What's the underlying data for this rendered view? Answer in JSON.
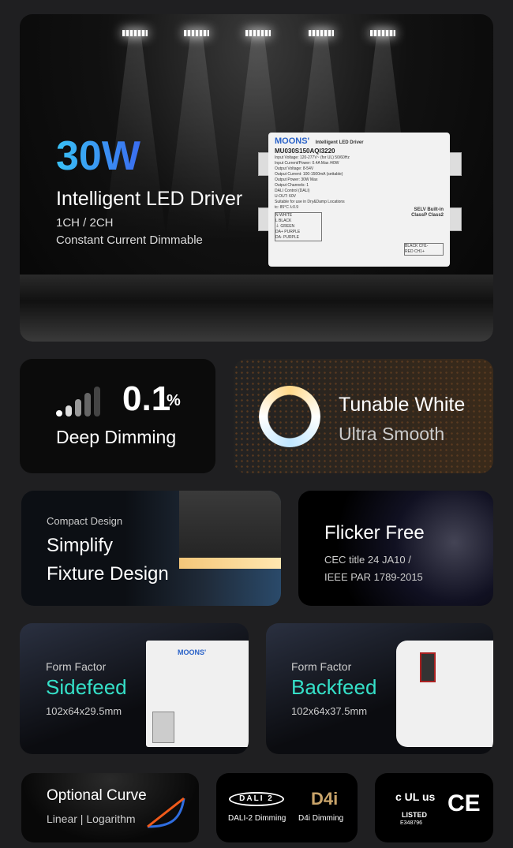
{
  "hero": {
    "power": "30W",
    "title": "Intelligent LED Driver",
    "channels": "1CH / 2CH",
    "subtitle": "Constant Current Dimmable",
    "label": {
      "brand": "MOONS'",
      "heading": "Intelligent LED Driver",
      "model": "MU030S150AQI3220",
      "lines": [
        "Input Voltage: 120-277V~ (for UL) 50/60Hz",
        "Input Current/Power: 0.4A Max /40W",
        "Output Voltage: 8-54V",
        "Output Current: 100-1500mA (settable)",
        "Output Power: 30W Max",
        "Output Channels: 1",
        "DALI Control (DALI)",
        "U-OUT: 60V",
        "Suitable for use in Dry&Damp Locations",
        "tc: 85°C  λ:0.9"
      ],
      "wiring": [
        "N WHITE",
        "L BLACK",
        "⏚ GREEN",
        "DA+ PURPLE",
        "DA- PURPLE"
      ],
      "outputs": [
        "BLACK CH1-",
        "RED CH1+"
      ],
      "selv": "SELV Built-in",
      "class": "ClassP Class2"
    }
  },
  "deep_dimming": {
    "value": "0.1",
    "unit": "%",
    "label": "Deep Dimming"
  },
  "tunable": {
    "title": "Tunable White",
    "subtitle": "Ultra Smooth"
  },
  "compact": {
    "kicker": "Compact Design",
    "line1": "Simplify",
    "line2": "Fixture Design"
  },
  "flicker": {
    "title": "Flicker Free",
    "line1": "CEC title 24 JA10 /",
    "line2": "IEEE PAR 1789-2015"
  },
  "sidefeed": {
    "kicker": "Form Factor",
    "title": "Sidefeed",
    "size": "102x64x29.5mm"
  },
  "backfeed": {
    "kicker": "Form Factor",
    "title": "Backfeed",
    "size": "102x64x37.5mm"
  },
  "curve": {
    "title": "Optional Curve",
    "subtitle": "Linear | Logarithm",
    "colors": {
      "linear": "#f05a1a",
      "log": "#2f6de0"
    }
  },
  "dali": {
    "logo": "DALI 2",
    "dali_label": "DALI-2 Dimming",
    "d4i_logo": "D4i",
    "d4i_label": "D4i Dimming"
  },
  "cert": {
    "ul": "c UL us",
    "listed": "LISTED",
    "number": "E348796",
    "ce": "CE"
  }
}
